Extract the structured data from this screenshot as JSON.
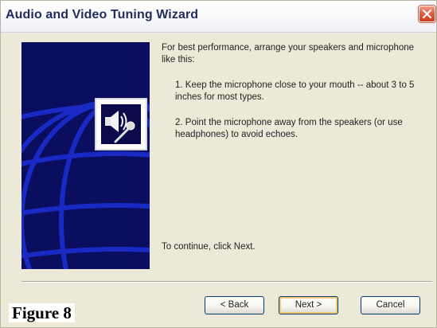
{
  "window": {
    "title": "Audio and Video Tuning Wizard"
  },
  "content": {
    "intro": "For best performance, arrange your speakers and microphone like this:",
    "items": [
      "1. Keep the microphone close to your mouth -- about 3 to 5 inches for most types.",
      "2. Point the microphone away from the speakers (or use headphones) to avoid echoes."
    ],
    "continue_text": "To continue, click Next."
  },
  "buttons": {
    "back": "< Back",
    "next": "Next >",
    "cancel": "Cancel"
  },
  "caption": "Figure 8",
  "icons": {
    "close": "close-icon",
    "illustration": "speaker-microphone-icon",
    "background": "globe-icon"
  },
  "colors": {
    "side_panel": "#0b0d5e",
    "globe_lines": "#1b2fd6",
    "window_bg": "#ece9d8",
    "close_button": "#e15a3c",
    "default_button_highlight": "#f5c973"
  }
}
